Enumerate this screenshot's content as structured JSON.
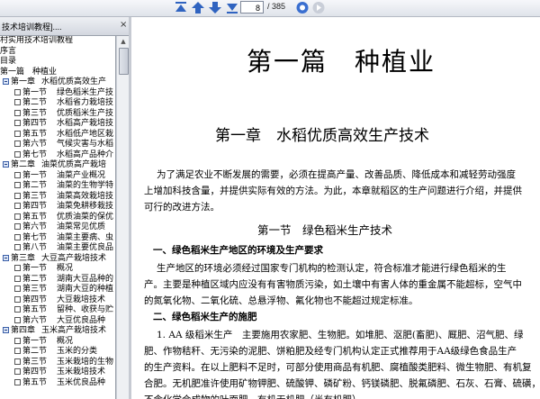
{
  "toolbar": {
    "page_current": "8",
    "page_total": "/ 385",
    "buttons": [
      "first-page",
      "previous-page",
      "next-page",
      "last-page",
      "go",
      "next"
    ]
  },
  "left_panel": {
    "tab_title": "技术培训教程]....",
    "close": "×",
    "tree": [
      {
        "type": "plain",
        "text": "村实用技术培训教程"
      },
      {
        "type": "plain",
        "text": "序言"
      },
      {
        "type": "plain",
        "text": "目录"
      },
      {
        "type": "plain",
        "text": "第一篇　种植业"
      },
      {
        "type": "chapter",
        "sec": "第一章",
        "text": "水稻优质高效生产"
      },
      {
        "type": "section",
        "sec": "第一节",
        "text": "绿色稻米生产技"
      },
      {
        "type": "section",
        "sec": "第二节",
        "text": "水稻省力栽培技"
      },
      {
        "type": "section",
        "sec": "第三节",
        "text": "优质稻米生产技"
      },
      {
        "type": "section",
        "sec": "第四节",
        "text": "水稻高产栽培技"
      },
      {
        "type": "section",
        "sec": "第五节",
        "text": "水稻低产地区栽"
      },
      {
        "type": "section",
        "sec": "第六节",
        "text": "气候灾害与水稻"
      },
      {
        "type": "section",
        "sec": "第七节",
        "text": "水稻高产品种介"
      },
      {
        "type": "chapter",
        "sec": "第二章",
        "text": "油菜优质高产栽培"
      },
      {
        "type": "section",
        "sec": "第一节",
        "text": "油菜产业概况"
      },
      {
        "type": "section",
        "sec": "第二节",
        "text": "油菜的生物学特"
      },
      {
        "type": "section",
        "sec": "第三节",
        "text": "油菜高效栽培技"
      },
      {
        "type": "section",
        "sec": "第四节",
        "text": "油菜免耕移栽技"
      },
      {
        "type": "section",
        "sec": "第五节",
        "text": "优质油菜的保优"
      },
      {
        "type": "section",
        "sec": "第六节",
        "text": "油菜常见优质"
      },
      {
        "type": "section",
        "sec": "第七节",
        "text": "油菜主要病、虫"
      },
      {
        "type": "section",
        "sec": "第八节",
        "text": "油菜主要优良品"
      },
      {
        "type": "chapter",
        "sec": "第三章",
        "text": "大豆高产栽培技术"
      },
      {
        "type": "section",
        "sec": "第一节",
        "text": "概况"
      },
      {
        "type": "section",
        "sec": "第二节",
        "text": "湖南大豆品种的"
      },
      {
        "type": "section",
        "sec": "第三节",
        "text": "湖南大豆的种植"
      },
      {
        "type": "section",
        "sec": "第四节",
        "text": "大豆栽培技术"
      },
      {
        "type": "section",
        "sec": "第五节",
        "text": "留种、收获与贮"
      },
      {
        "type": "section",
        "sec": "第六节",
        "text": "大豆优良品种"
      },
      {
        "type": "chapter",
        "sec": "第四章",
        "text": "玉米高产栽培技术"
      },
      {
        "type": "section",
        "sec": "第一节",
        "text": "概况"
      },
      {
        "type": "section",
        "sec": "第二节",
        "text": "玉米的分类"
      },
      {
        "type": "section",
        "sec": "第三节",
        "text": "玉米栽培的生物"
      },
      {
        "type": "section",
        "sec": "第四节",
        "text": "玉米栽培技术"
      },
      {
        "type": "section",
        "sec": "第五节",
        "text": "玉米优良品种"
      }
    ]
  },
  "document": {
    "part_title": "第一篇　种植业",
    "chapter_title": "第一章　水稻优质高效生产技术",
    "intro": [
      "为了满足农业不断发展的需要，必须在提高产量、改善品质、降低成本和减轻劳动强度",
      "上增加科技含量，并提供实际有效的方法。为此，本章就稻区的生产问题进行介绍，并提供",
      "可行的改进方法。"
    ],
    "section_title": "第一节　绿色稻米生产技术",
    "subhead1": "一、绿色稻米生产地区的环境及生产要求",
    "para1": [
      "生产地区的环境必须经过国家专门机构的检测认定，符合标准才能进行绿色稻米的生",
      "产。主要是种植区域内应没有有害物质污染，如土壤中有害人体的重金属不能超标，空气中",
      "的氮氧化物、二氧化硫、总悬浮物、氟化物也不能超过规定标准。"
    ],
    "subhead2": "二、绿色稻米生产的施肥",
    "para2": [
      "1. AA 级稻米生产　主要施用农家肥、生物肥。如堆肥、沤肥(畜肥)、厩肥、沼气肥、绿",
      "肥、作物秸秆、无污染的泥肥、饼粕肥及经专门机构认定正式推荐用于AA级绿色食品生产",
      "的生产资料。在以上肥料不足时，可部分使用商品有机肥、腐植酸类肥料、微生物肥、有机复",
      "合肥。无机肥准许使用矿物钾肥、硫酸钾、磷矿粉、钙镁磷肥、脱氟磷肥、石灰、石膏、硫磺，",
      "不含化学合成物的叶面肥、有机无机肥（半有机肥）。"
    ]
  }
}
